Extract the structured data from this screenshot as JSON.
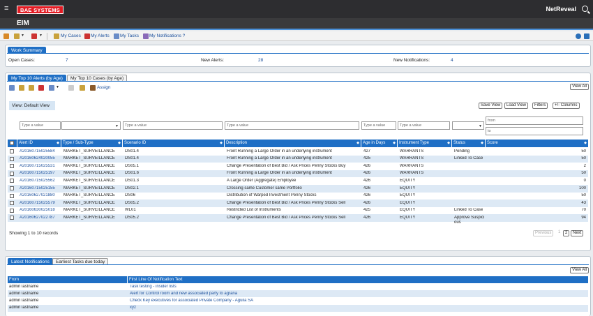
{
  "header": {
    "brand": "BAE SYSTEMS",
    "product": "NetReveal",
    "page_title": "EIM"
  },
  "toolbar": {
    "links": [
      "My Cases",
      "My Alerts",
      "My Tasks",
      "My Notifications ?"
    ]
  },
  "work_summary": {
    "tab": "Work Summary",
    "open_cases_label": "Open Cases:",
    "open_cases_value": "7",
    "new_alerts_label": "New Alerts:",
    "new_alerts_value": "28",
    "new_notifications_label": "New Notifications:",
    "new_notifications_value": "4"
  },
  "alerts_panel": {
    "tabs": [
      "My Top 10 Alerts (by Age)",
      "My Top 10 Cases (by Age)"
    ],
    "assign": "Assign",
    "view_all": "View All",
    "view_label": "View: Default View",
    "buttons": [
      "Save View",
      "Load View",
      "Filters",
      "+/- Columns"
    ],
    "filter_placeholder": "Type a value",
    "score_from": "from",
    "score_to": "to",
    "columns": [
      "Alert ID",
      "Type / Sub-Type",
      "Scenario ID",
      "Description",
      "Age in Days",
      "Instrument Type",
      "Status",
      "Score"
    ],
    "rows": [
      [
        "A20160715025584",
        "MARKET_SURVEILLANCE",
        "DS01.4",
        "Front Running a Large Order in an underlying instrument",
        "427",
        "WARRANTS",
        "Pending",
        "50"
      ],
      [
        "A20160624020055",
        "MARKET_SURVEILLANCE",
        "DS01.4",
        "Front Running a Large Order in an underlying instrument",
        "425",
        "WARRANTS",
        "Linked To Case",
        "50"
      ],
      [
        "A20160715025531",
        "MARKET_SURVEILLANCE",
        "DS05.1",
        "Change Presentation of Best Bid / Ask Prices Penny Stocks Buy",
        "426",
        "WARRANTS",
        "",
        "2"
      ],
      [
        "A20160715025197",
        "MARKET_SURVEILLANCE",
        "DS01.6",
        "Front Running a Large Order in an underlying instrument",
        "426",
        "WARRANTS",
        "",
        "50"
      ],
      [
        "A20160715025562",
        "MARKET_SURVEILLANCE",
        "DS01.3",
        "A Large Order (Aggregate) Employee",
        "426",
        "EQUITY",
        "",
        "0"
      ],
      [
        "A20160715025155",
        "MARKET_SURVEILLANCE",
        "DS02.1",
        "Crossing same Customer same Portfolio",
        "426",
        "EQUITY",
        "",
        "100"
      ],
      [
        "A20160627021880",
        "MARKET_SURVEILLANCE",
        "DS06",
        "Distribution of Warped Investment Penny Stocks",
        "426",
        "EQUITY",
        "",
        "50"
      ],
      [
        "A20160715025579",
        "MARKET_SURVEILLANCE",
        "DS05.2",
        "Change Presentation of Best Bid / Ask Prices Penny Stocks Sell",
        "426",
        "EQUITY",
        "",
        "43"
      ],
      [
        "A20160630025018",
        "MARKET_SURVEILLANCE",
        "WL01",
        "Restricted List of Instruments",
        "425",
        "EQUITY",
        "Linked To Case",
        "70"
      ],
      [
        "A20160627022787",
        "MARKET_SURVEILLANCE",
        "DS05.2",
        "Change Presentation of Best Bid / Ask Prices Penny Stocks Sell",
        "426",
        "EQUITY",
        "Approve Suspici ous",
        "94"
      ]
    ],
    "showing": "Showing 1 to 10 records",
    "pager": [
      "Previous",
      "1",
      "2",
      "Next"
    ]
  },
  "notifications_panel": {
    "tabs": [
      "Latest Notifications",
      "Earliest Tasks due today"
    ],
    "view_all": "View All",
    "columns": [
      "From",
      "First Line Of Notification Text"
    ],
    "rows": [
      [
        "admin lastname",
        "Task testing - insider lists"
      ],
      [
        "admin lastname",
        "Alert for Control room and new associated party to agrana"
      ],
      [
        "admin lastname",
        "Check Key executives for associated Private Company - Aguila SA"
      ],
      [
        "admin lastname",
        "xyz"
      ]
    ]
  }
}
